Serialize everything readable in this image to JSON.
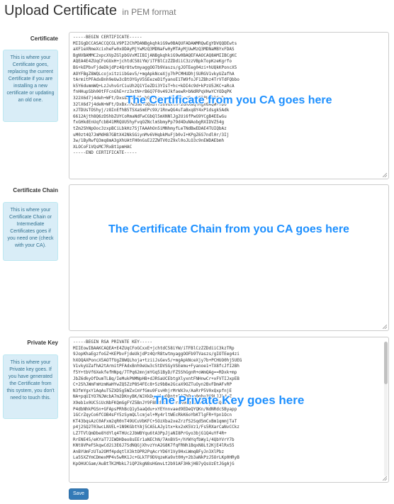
{
  "header": {
    "title": "Upload Certificate",
    "subtitle": "in PEM format"
  },
  "certificate": {
    "label": "Certificate",
    "help": "This is where your Certificate goes, replacing the current Certificate if you are installing a new certificate or updating an old one.",
    "overlay": "The Certificate from you CA goes here",
    "value": "-----BEGIN CERTIFICATE-----\nMIIGgDCCASACCQCGLV9PI2ChPDANBgkqhkiG9w0BAQUFADAWMRQwEgYDVQQDEwts\naXF1eXRmeXcixheFw0xODAyMjYwMzQ3MDNaFw0yMTAyMjUwMzQ3MDNaMBYxFDAS\nBgNVBAMMC2xpcXVpZGlpbGVxMIIBIjANBgkqhkiG9w0BAQEFAAOCAQ8AMIIBCgKC\nAQEA4E4ZUqCFoGUxH+jchtdC58iYW/iTFBlCzZZDdiiC3zzVBpkTopKzeKgrfo\nBG+kEPbvFjdeDkjdPz4Qr8twtmyaggOO7b9Vaszs/gJOTEeg04zi+hUQkKPoncX5\nAOYFBgZ8WQLcojxitziibGev5/+mgApkNceXjy7hPCMHUDhjSURGV1vkyUZafhA\ntArmitPFAdxBnh9eUw3cBtOYGyV5SEezeD1fyanoE1TW9foJF1ZBhz4TrVTdFQbbo\nk5Y6dummWQ+LzJvhvGrCiuUh2Q1YIeZDi3YIsT+hc+kDI4c9d+kPzU5JKC+aRcA\nfnHHupSbh00tFFcnGhE+rz3xtN+rB6Q7F0v49JkfaewR+bNdRPqVHwYCYODqPK\n322X6d7j4deh+WFt/Dxs8xPRsPlsb9t+Bsn+oeZbTksomSm+CClPLX1DC+Dx\n32lX6d7j4deN+WFt/DxBx7Pe3N6+GQxBTTz6vdxlH+2dRXaqTRgx6AQW+7D6\nxJTDUsTOShyj/z8InEfhB5T5XaSmEPc9X/1RnwQG4uTaBxq8Y4xP1dsgk5Adk\n6612Ajth8Q6zDShbZUYCoRmaNdFwCGbQl5mXNNlJg2Ui6fPwG9YCgB4EEwGu\nfxGHkdEnUqfcbB41MRQUU5hyFvqOZNclmSbmyPp79d4DuNAobgRXIDVZ54g\ntZm2ShNpOoc3zxpBCiLbkHz7SjTAAAhOn5iMNhmyfLeTNdBwEDAE4TUIQbAz\nuM0zt4Q7JmMdH87GBtX42NkSGiynMv6VHqbkMuFjb0vI+KPgZ6S7ndl0r/3Ij\n3w/1ByRwfQ3mq8mA3gXhUAtFH0nGsE2ZZWTV0zZ9xl0oJLO3c9nEWDAEbmh\nXLOCoF1VQsMC7RxBt1pmHAC\n-----END CERTIFICATE-----"
  },
  "chain": {
    "label": "Certificate Chain",
    "help": "This is where your Certificate Chain or Intermediate Certificates goes if you need one (check with your CA).",
    "overlay": "The Certificate Chain from you CA goes here",
    "value": ""
  },
  "private_key": {
    "label": "Private Key",
    "help": "This is where your Private key goes. If you have generated the Certificate from this system, you don't need to touch this.",
    "overlay": "The Private Key goes here",
    "value": "-----BEGIN RSA PRIVATE KEY-----\nMIIEowIBAAKCAQEA+E4ZUqCFoGCxxE+jchtdC58iYW/iTFBlCzZZDdiiC3kzTRp\n9JopKhaEgzfoGZ+KEPbvFjdeUkjdPz4QrR8twtmyaggOOFb9TVaszs/gIOTEeg4zi\nhXOQAXPoncX5AOTfUgZ8WQLhoja+tziiJsGev5/+mgApkNceXjy7b+PCHUO0hj5UEG\nV1vkyUZafhA2tArmitPFAdxBnh9eUw3c5tDVSGyVSEemu+Fyanoe1+TX8fcJfI2Bh\nf5Y+tbVf6XekfefHNpq/7TPq62mnjmYGq51ByD/FZ5ShGgnR+oWmQAg==RDxk+mp\nJbZ6dkyOfDumTLBq/IeMukPNMNpHB+dJRSaUCEbtgXlyxntFNHnwCr+xFVTIJxpEB\nC+2ShJWmFmHzmNaHYwZQ5ZzP8S4FEc8+5z9bBe2GcaX9OZTuOyn2BvFDmAFvRP\nN3fmYgxY1AqAuT5ZXD5g5WZxCmYfGmu9FsvHhjrMrWX3v/AaRrP5V0xQxpfnjE\nNA+pqUIYO7NJWcbA7m2DKnyBK/WJXkDgrHbuQDnt+5AZhD+n0gbu3K9LJJhdoZ\nX9eb1x0UC5iUcNbFKQmGgFYZ5BnJY9F8MzhXv7vTrmK0nQiGa0LOiybh3Qev\nP4dbNhkPGSn+GFApsPRhBcQ1y5aaQdu+xYEYnnvaed9EDeQYQKn/NdNRdcSByapp\n1GCrZqyCo6fCOB4sFY5zSymQLlcmjel+My4rltWEcRkK6oYbKTlgFR+Ypn1Ocn\nKT43bqsAzC0AFxm2qR0nT49UCuVbKFC+5OzXba2xeZrzfS2Sqd5mCxBm1qmmjTaT\np4j2SQ2T03wcLNVEL+1N9KGbtYAj5CA5LAJy1tx+kx2xK5Vz1/Fs5RXarCaNvCCkz\nLZ7TVlQmDbe8YdYlq4THUc2JbWBYqu6tA3PpJjaNI8PrGyo3bjG1Q4uYF4R+\nRrENE45/eKYaT7JIWDHDeo8sEEr1aNEChN/7AnBVS+/hYWYqfbWy1/4QbYVrY7b\nKNt8VPeFSkqwCd2i3E6J7SdNQGjXhvzYnA2G8K7fqFRNh1BqxN8Lt2KjE4lRxS5\nAnBYUmFzUTa2OMf4pdqtlX3ktOPR2PqAcrYD6Y1Vy9HxLWmqBFyJn3XlPbz\nLa5SXZYmCDmexMP4v5wRK1Jc+GLkTF9DVqzeKa9xt0Hy+2b3aNkPzJ5OrLKp0HRyB\nKpOHUCGam/AuBtTK2MbkL7iQP2kgN8sHGmvLt2b91AF3HkjHB7yQsUzEtJGgAjG"
  },
  "actions": {
    "save_label": "Save"
  }
}
